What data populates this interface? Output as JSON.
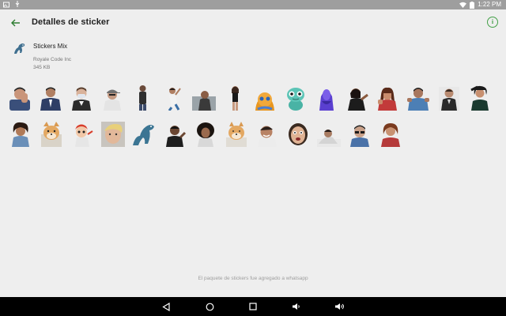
{
  "status_bar": {
    "time": "1:22 PM"
  },
  "app_bar": {
    "title": "Detalles de sticker",
    "back_icon": "arrow-back-icon",
    "info_icon": "info-icon",
    "accent_color": "#43a047"
  },
  "pack": {
    "name": "Stickers Mix",
    "publisher": "Royale Code Inc",
    "size": "345 KB"
  },
  "stickers": {
    "row1": [
      {
        "label": "man-face-palm"
      },
      {
        "label": "man-in-suit"
      },
      {
        "label": "man-with-mask"
      },
      {
        "label": "man-with-cap"
      },
      {
        "label": "man-standing"
      },
      {
        "label": "person-dancing"
      },
      {
        "label": "man-sitting"
      },
      {
        "label": "woman-standing"
      },
      {
        "label": "orange-creature"
      },
      {
        "label": "teal-creature"
      },
      {
        "label": "purple-figure"
      },
      {
        "label": "woman-pointing"
      },
      {
        "label": "woman-with-hands"
      },
      {
        "label": "man-shrugging"
      },
      {
        "label": "man-blue-shirt"
      },
      {
        "label": "woman-long-hair"
      }
    ],
    "row2": [
      {
        "label": "woman-curly-hair"
      },
      {
        "label": "shiba-dog"
      },
      {
        "label": "cartoon-character"
      },
      {
        "label": "blond-man"
      },
      {
        "label": "blue-dinosaur"
      },
      {
        "label": "man-gesturing"
      },
      {
        "label": "woman-afro"
      },
      {
        "label": "shiba-dog-2"
      },
      {
        "label": "man-smiling"
      },
      {
        "label": "woman-surprised"
      },
      {
        "label": "man-lying"
      },
      {
        "label": "man-glasses"
      },
      {
        "label": "woman-red-hair"
      }
    ]
  },
  "footer": {
    "note": "El paquete de stickers fue agregado a whatsapp"
  },
  "nav": {
    "back_icon": "nav-back-icon",
    "home_icon": "nav-home-icon",
    "recents_icon": "nav-recents-icon",
    "volume_down_icon": "volume-down-icon",
    "volume_up_icon": "volume-up-icon"
  }
}
